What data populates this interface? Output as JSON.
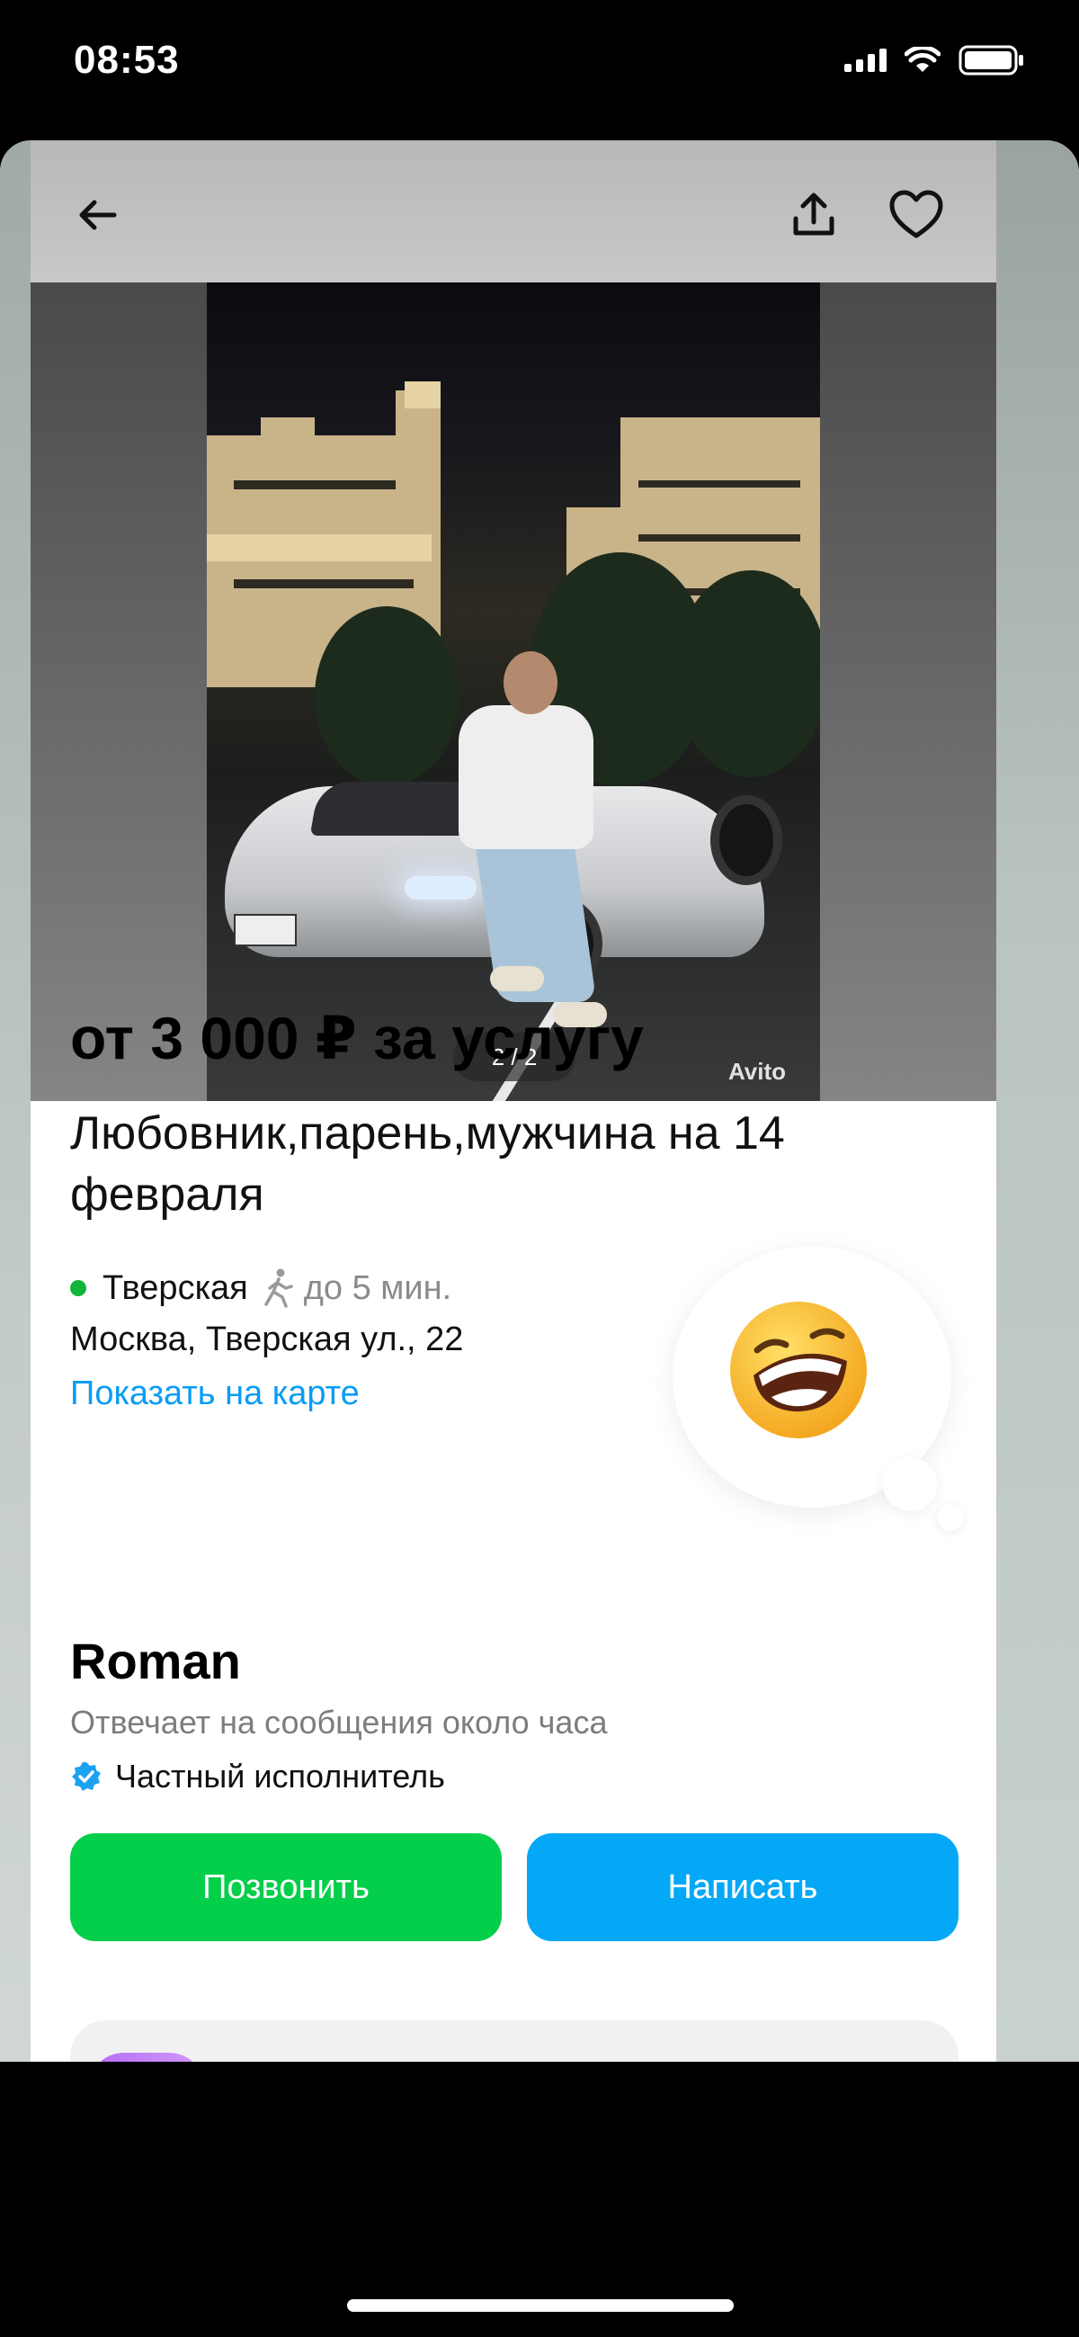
{
  "status_bar": {
    "time": "08:53"
  },
  "gallery": {
    "counter": "2 / 2",
    "watermark": "Avito"
  },
  "listing": {
    "price": "от 3 000 ₽ за услугу",
    "title": "Любовник,парень,мужчина на 14 февраля",
    "metro_station": "Тверская",
    "metro_walk": "до 5 мин.",
    "address": "Москва, Тверская ул., 22",
    "map_link": "Показать на карте"
  },
  "seller": {
    "name": "Roman",
    "reply_time": "Отвечает на сообщения около часа",
    "type": "Частный исполнитель"
  },
  "actions": {
    "call_label": "Позвонить",
    "write_label": "Написать"
  },
  "colors": {
    "call_button": "#04cf4a",
    "write_button": "#05a8f6",
    "link": "#0a9cf5",
    "metro_line": "#13b538"
  },
  "icons": {
    "back": "arrow-left-icon",
    "share": "share-icon",
    "favorite": "heart-icon",
    "walk": "walking-person-icon",
    "verified": "verified-badge-icon",
    "emoji": "laughing-emoji-icon"
  }
}
